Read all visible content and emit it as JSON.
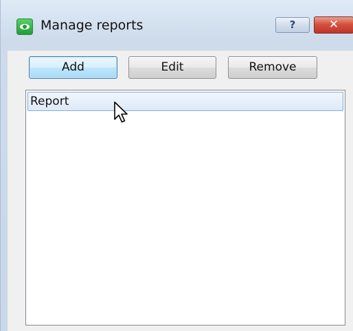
{
  "window": {
    "title": "Manage reports",
    "help_label": "?",
    "close_label": "✕"
  },
  "toolbar": {
    "add_label": "Add",
    "edit_label": "Edit",
    "remove_label": "Remove"
  },
  "reports_list": {
    "items": [
      {
        "label": "Report",
        "state": "hover"
      }
    ]
  },
  "icons": {
    "app": "eye-icon",
    "cursor": "mouse-pointer-icon"
  },
  "colors": {
    "title_bar": "#cddbeb",
    "close_button": "#c0342a",
    "focused_button": "#bee6fd",
    "list_selection": "#dde9f8",
    "app_icon": "#1f9a33"
  }
}
